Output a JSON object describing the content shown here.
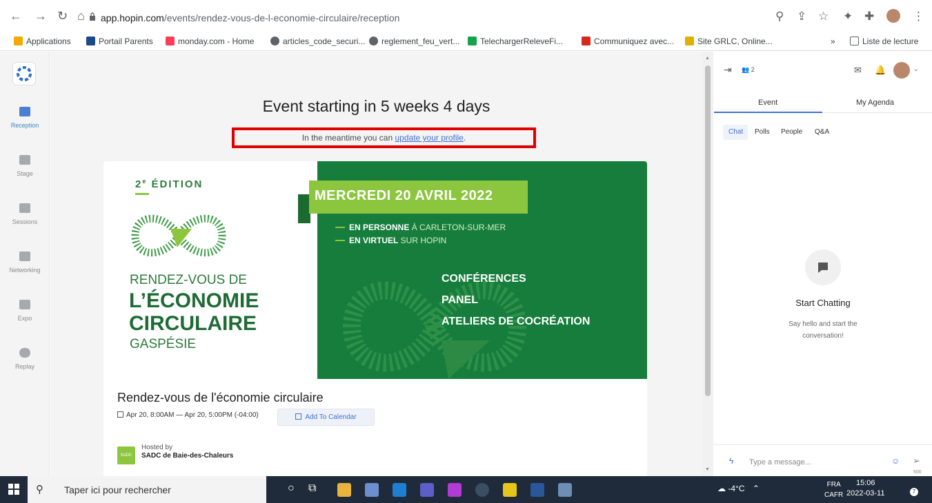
{
  "browser": {
    "url_host": "app.hopin.com",
    "url_path": "/events/rendez-vous-de-l-economie-circulaire/reception",
    "bookmarks": [
      {
        "label": "Applications",
        "color": "#f2a900"
      },
      {
        "label": "Portail Parents",
        "color": "#1a4a8a"
      },
      {
        "label": "monday.com - Home",
        "color": "#ff3d57"
      },
      {
        "label": "articles_code_securi...",
        "color": "#5f6368"
      },
      {
        "label": "reglement_feu_vert...",
        "color": "#5f6368"
      },
      {
        "label": "TelechargerReleveFi...",
        "color": "#16a34a"
      },
      {
        "label": "Communiquez avec...",
        "color": "#d52b1e"
      },
      {
        "label": "Site GRLC, Online...",
        "color": "#e0b000"
      }
    ],
    "bookmarks_more": "»",
    "reading_list": "Liste de lecture"
  },
  "rail": [
    {
      "label": "Reception",
      "icon": "home-icon",
      "active": true
    },
    {
      "label": "Stage",
      "icon": "video-camera-icon",
      "active": false
    },
    {
      "label": "Sessions",
      "icon": "group-icon",
      "active": false
    },
    {
      "label": "Networking",
      "icon": "handshake-icon",
      "active": false
    },
    {
      "label": "Expo",
      "icon": "booth-icon",
      "active": false
    },
    {
      "label": "Replay",
      "icon": "play-icon",
      "active": false
    }
  ],
  "main": {
    "countdown": "Event starting in 5 weeks 4 days",
    "meantime_prefix": "In the meantime you can ",
    "meantime_link": "update your profile",
    "meantime_suffix": ".",
    "banner": {
      "edition_num": "2",
      "edition_sup": "e",
      "edition_word": "ÉDITION",
      "title_line1": "RENDEZ-VOUS DE",
      "title_line2": "L’ÉCONOMIE",
      "title_line3": "CIRCULAIRE",
      "title_line4": "GASPÉSIE",
      "date": "MERCREDI 20 AVRIL 2022",
      "mode1_bold": "EN PERSONNE",
      "mode1_rest": " À CARLETON-SUR-MER",
      "mode2_bold": "EN VIRTUEL",
      "mode2_rest": " SUR HOPIN",
      "program": [
        "CONFÉRENCES",
        "PANEL",
        "ATELIERS DE COCRÉATION"
      ]
    },
    "event_title": "Rendez-vous de l'économie circulaire",
    "event_dates": "Apr 20, 8:00AM — Apr 20, 5:00PM (-04:00)",
    "add_to_calendar": "Add To Calendar",
    "hosted_by": "Hosted by",
    "host_name": "SADC de Baie-des-Chaleurs",
    "host_logo_text": "SADC"
  },
  "panel": {
    "attendees": "2",
    "tabs": [
      "Event",
      "My Agenda"
    ],
    "subtabs": [
      "Chat",
      "Polls",
      "People",
      "Q&A"
    ],
    "empty_title": "Start Chatting",
    "empty_body": "Say hello and start the conversation!",
    "message_placeholder": "Type a message...",
    "char_count": "500"
  },
  "taskbar": {
    "search_placeholder": "Taper ici pour rechercher",
    "weather": "-4°C",
    "lang1": "FRA",
    "lang2": "CAFR",
    "time": "15:06",
    "date": "2022-03-11",
    "notifications": "7"
  }
}
